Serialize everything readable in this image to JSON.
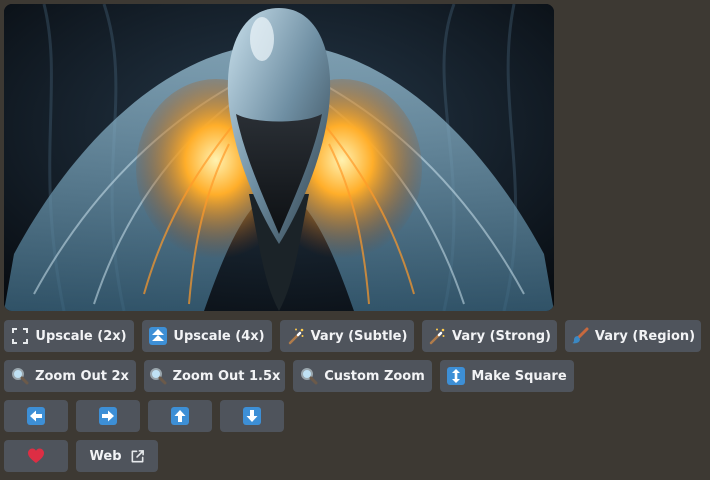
{
  "image": {
    "subject": "armored-figure-with-glowing-feathers"
  },
  "colors": {
    "button_bg": "#4f545c",
    "page_bg": "#3d3933",
    "arrow_tile": "#3d8fd6",
    "heart": "#dd2e44"
  },
  "row1": {
    "upscale2x": {
      "label": "Upscale (2x)",
      "icon": "expand-corners-icon"
    },
    "upscale4x": {
      "label": "Upscale (4x)",
      "icon": "up-double-arrow-icon"
    },
    "vary_subtle": {
      "label": "Vary (Subtle)",
      "icon": "magic-wand-icon"
    },
    "vary_strong": {
      "label": "Vary (Strong)",
      "icon": "magic-wand-icon"
    },
    "vary_region": {
      "label": "Vary (Region)",
      "icon": "paintbrush-icon"
    }
  },
  "row2": {
    "zoom2x": {
      "label": "Zoom Out 2x",
      "icon": "magnifier-icon"
    },
    "zoom15x": {
      "label": "Zoom Out 1.5x",
      "icon": "magnifier-icon"
    },
    "custom_zoom": {
      "label": "Custom Zoom",
      "icon": "magnifier-icon"
    },
    "make_square": {
      "label": "Make Square",
      "icon": "up-down-arrow-icon"
    }
  },
  "row3": {
    "pan_left": {
      "icon": "arrow-left-icon"
    },
    "pan_right": {
      "icon": "arrow-right-icon"
    },
    "pan_up": {
      "icon": "arrow-up-icon"
    },
    "pan_down": {
      "icon": "arrow-down-icon"
    }
  },
  "row4": {
    "favorite": {
      "icon": "heart-icon"
    },
    "web": {
      "label": "Web",
      "icon": "external-link-icon"
    }
  }
}
